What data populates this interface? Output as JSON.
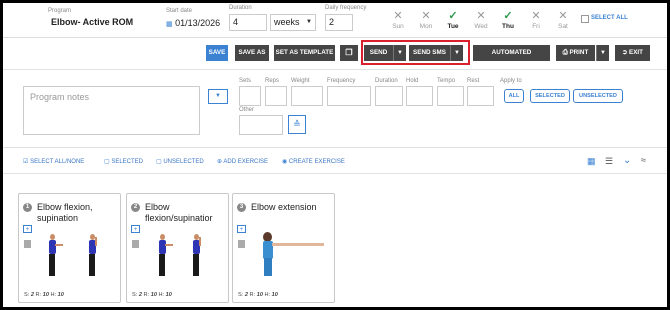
{
  "header": {
    "program_label": "Program",
    "program_value": "Elbow- Active ROM",
    "start_label": "Start date",
    "start_value": "01/13/2026",
    "duration_label": "Duration",
    "duration_value": "4",
    "duration_unit": "weeks",
    "daily_label": "Daily frequency",
    "daily_value": "2",
    "days": [
      {
        "name": "Sun",
        "selected": false
      },
      {
        "name": "Mon",
        "selected": false
      },
      {
        "name": "Tue",
        "selected": true
      },
      {
        "name": "Wed",
        "selected": false
      },
      {
        "name": "Thu",
        "selected": true
      },
      {
        "name": "Fri",
        "selected": false
      },
      {
        "name": "Sat",
        "selected": false
      }
    ],
    "select_all": "SELECT ALL"
  },
  "toolbar": {
    "save": "SAVE",
    "save_as": "SAVE AS",
    "save_template": "SET AS TEMPLATE",
    "send": "SEND",
    "send_sms": "SEND SMS",
    "automated": "AUTOMATED MESSAGES",
    "print": "PRINT",
    "exit": "EXIT"
  },
  "notes": {
    "placeholder": "Program notes"
  },
  "params": {
    "sets": "Sets",
    "reps": "Reps",
    "weight": "Weight",
    "frequency": "Frequency",
    "duration": "Duration",
    "hold": "Hold",
    "tempo": "Tempo",
    "rest": "Rest",
    "other": "Other",
    "apply_to": "Apply to",
    "all": "ALL",
    "selected": "SELECTED",
    "unselected": "UNSELECTED"
  },
  "bar": {
    "select_all": "SELECT ALL/NONE",
    "selected": "SELECTED",
    "unselected": "UNSELECTED",
    "add": "ADD EXERCISE",
    "create": "CREATE EXERCISE"
  },
  "exercises": [
    {
      "num": "1",
      "title_line1": "Elbow flexion,",
      "title_line2": "supination",
      "s_label": "S:",
      "s": "2",
      "r_label": "R:",
      "r": "10",
      "h_label": "H:",
      "h": "10"
    },
    {
      "num": "2",
      "title_line1": "Elbow",
      "title_line2": "flexion/supinatior",
      "s_label": "S:",
      "s": "2",
      "r_label": "R:",
      "r": "10",
      "h_label": "H:",
      "h": "10"
    },
    {
      "num": "3",
      "title_line1": "Elbow extension",
      "title_line2": "",
      "s_label": "S:",
      "s": "2",
      "r_label": "R:",
      "r": "10",
      "h_label": "H:",
      "h": "10"
    }
  ],
  "colors": {
    "accent": "#3c82d2",
    "dark_button": "#454545",
    "highlight": "#d9202c",
    "check": "#2e9a4a"
  }
}
